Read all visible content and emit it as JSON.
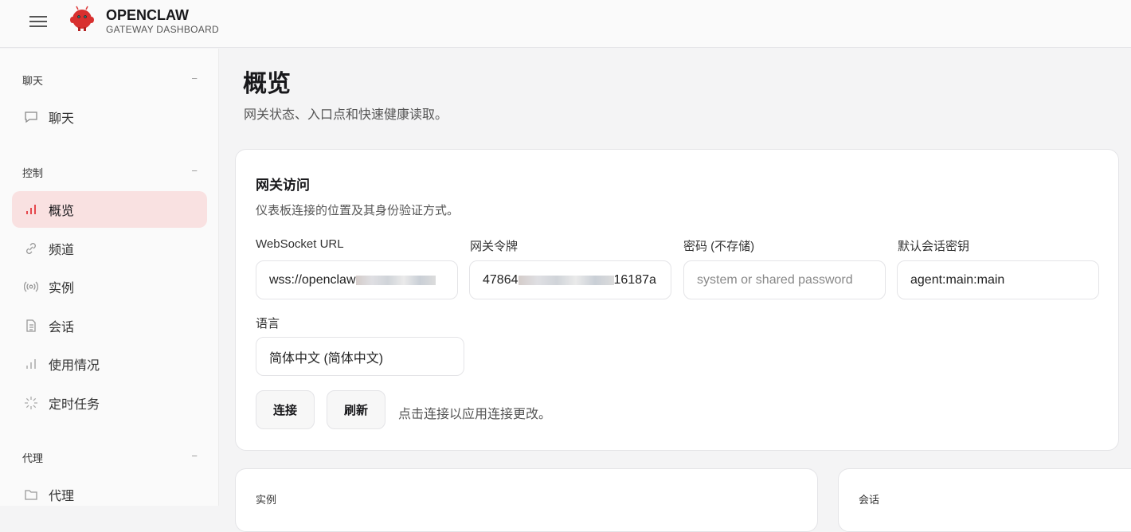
{
  "header": {
    "brand": "OPENCLAW",
    "subtitle": "GATEWAY DASHBOARD"
  },
  "sidebar": {
    "groups": [
      {
        "label": "聊天",
        "collapse": "−"
      },
      {
        "label": "控制",
        "collapse": "−"
      },
      {
        "label": "代理",
        "collapse": "−"
      }
    ],
    "items": [
      {
        "label": "聊天",
        "icon": "message-icon"
      },
      {
        "label": "概览",
        "icon": "bar-chart-icon",
        "active": true
      },
      {
        "label": "频道",
        "icon": "link-icon"
      },
      {
        "label": "实例",
        "icon": "broadcast-icon"
      },
      {
        "label": "会话",
        "icon": "file-icon"
      },
      {
        "label": "使用情况",
        "icon": "bar-chart-icon"
      },
      {
        "label": "定时任务",
        "icon": "loader-icon"
      },
      {
        "label": "代理",
        "icon": "folder-icon"
      }
    ]
  },
  "page": {
    "title": "概览",
    "description": "网关状态、入口点和快速健康读取。"
  },
  "access": {
    "title": "网关访问",
    "description": "仪表板连接的位置及其身份验证方式。",
    "ws_label": "WebSocket URL",
    "ws_value": "wss://openclaw",
    "ws_value_tail": "",
    "token_label": "网关令牌",
    "token_value": "47864",
    "token_tail": "16187a",
    "password_label": "密码 (不存储)",
    "password_placeholder": "system or shared password",
    "session_label": "默认会话密钥",
    "session_value": "agent:main:main",
    "lang_label": "语言",
    "lang_value": "简体中文 (简体中文)",
    "connect": "连接",
    "refresh": "刷新",
    "hint": "点击连接以应用连接更改。"
  },
  "cards": {
    "instances": "实例",
    "sessions": "会话"
  },
  "colors": {
    "accent": "#e5484d",
    "active_bg": "#f9e1e1"
  }
}
